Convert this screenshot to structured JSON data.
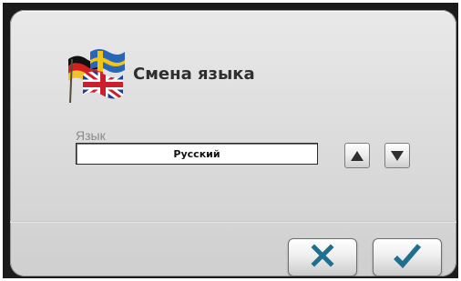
{
  "dialog": {
    "title": "Смена языка",
    "language_label": "Язык",
    "language_value": "Русский"
  },
  "icons": {
    "flags": "language-flags-icon",
    "up": "triangle-up-icon",
    "down": "triangle-down-icon",
    "cancel": "x-icon",
    "confirm": "checkmark-icon"
  },
  "colors": {
    "action_icon": "#1f6f8f"
  }
}
